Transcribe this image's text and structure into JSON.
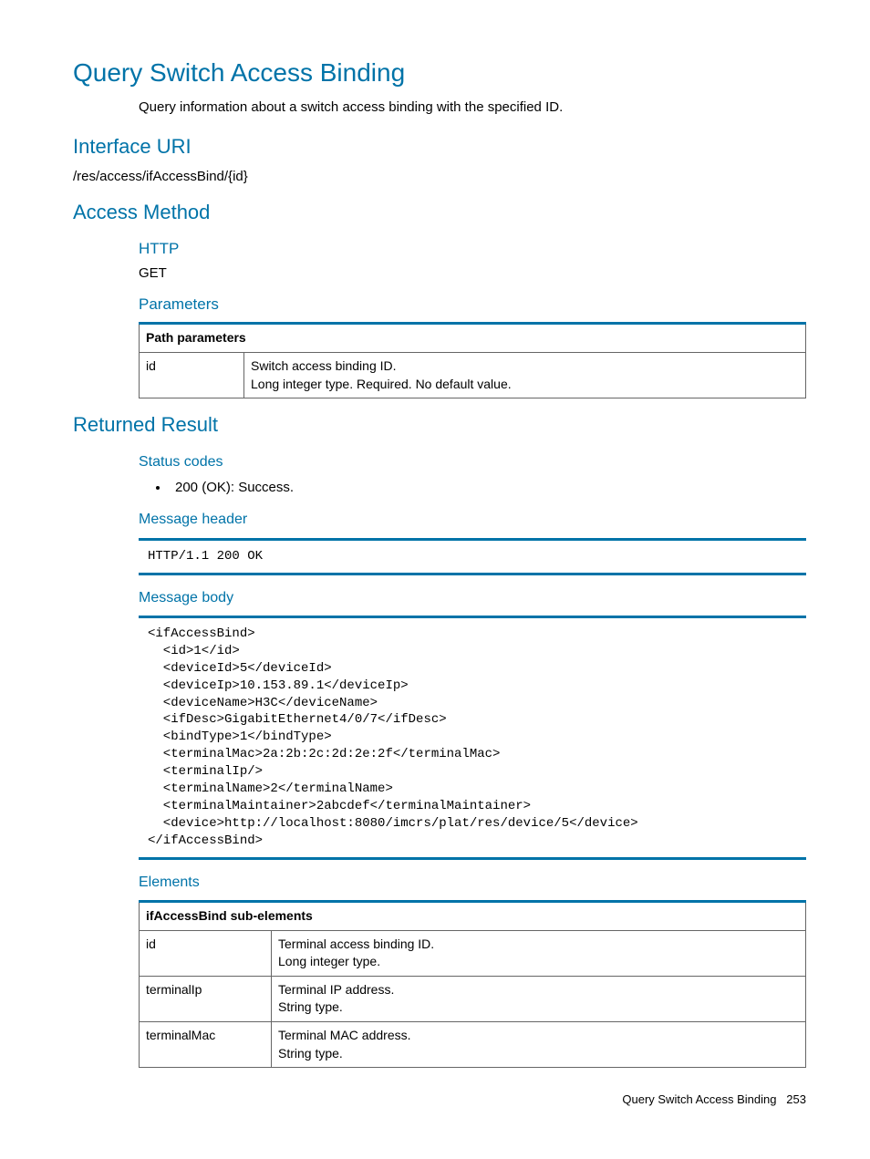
{
  "title": "Query Switch Access Binding",
  "description": "Query information about a switch access binding with the specified ID.",
  "interface_uri": {
    "heading": "Interface URI",
    "value": "/res/access/ifAccessBind/{id}"
  },
  "access_method": {
    "heading": "Access Method",
    "http_label": "HTTP",
    "http_value": "GET",
    "parameters_label": "Parameters",
    "path_params_header": "Path parameters",
    "params": [
      {
        "name": "id",
        "line1": "Switch access binding ID.",
        "line2": "Long integer type. Required. No default value."
      }
    ]
  },
  "returned_result": {
    "heading": "Returned Result",
    "status_codes_label": "Status codes",
    "status_codes": [
      "200 (OK): Success."
    ],
    "message_header_label": "Message header",
    "message_header_code": "HTTP/1.1 200 OK",
    "message_body_label": "Message body",
    "message_body_code": "<ifAccessBind>\n  <id>1</id>\n  <deviceId>5</deviceId>\n  <deviceIp>10.153.89.1</deviceIp>\n  <deviceName>H3C</deviceName>\n  <ifDesc>GigabitEthernet4/0/7</ifDesc>\n  <bindType>1</bindType>\n  <terminalMac>2a:2b:2c:2d:2e:2f</terminalMac>\n  <terminalIp/>\n  <terminalName>2</terminalName>\n  <terminalMaintainer>2abcdef</terminalMaintainer>\n  <device>http://localhost:8080/imcrs/plat/res/device/5</device>\n</ifAccessBind>",
    "elements_label": "Elements",
    "elements_header": "ifAccessBind sub-elements",
    "elements": [
      {
        "name": "id",
        "line1": "Terminal access binding ID.",
        "line2": "Long integer type."
      },
      {
        "name": "terminalIp",
        "line1": "Terminal IP address.",
        "line2": "String type."
      },
      {
        "name": "terminalMac",
        "line1": "Terminal MAC address.",
        "line2": "String type."
      }
    ]
  },
  "footer": {
    "title": "Query Switch Access Binding",
    "page": "253"
  }
}
